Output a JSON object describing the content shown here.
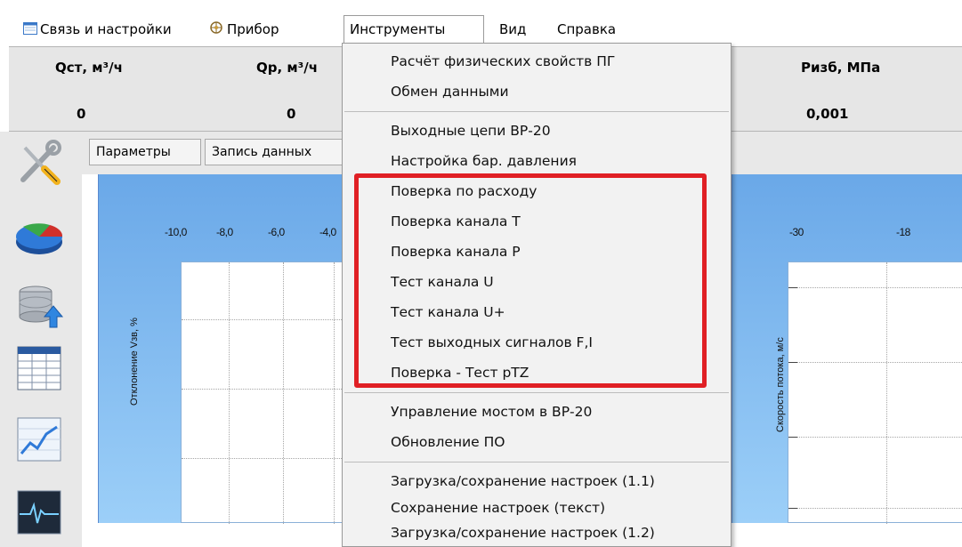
{
  "menubar": {
    "items": [
      {
        "label": "Связь и настройки",
        "icon": "window-icon"
      },
      {
        "label": "Прибор",
        "icon": "device-icon"
      },
      {
        "label": "Инструменты",
        "active": true
      },
      {
        "label": "Вид"
      },
      {
        "label": "Справка"
      }
    ]
  },
  "measurements": [
    {
      "label": "Qст, м³/ч",
      "value": "0"
    },
    {
      "label": "Qр, м³/ч",
      "value": "0"
    },
    {
      "label": "Ризб, МПа",
      "value": "0,001"
    }
  ],
  "tabs": [
    {
      "label": "Параметры"
    },
    {
      "label": "Запись данных"
    }
  ],
  "left_toolbar": {
    "icons": [
      "tools-icon",
      "pie-chart-icon",
      "database-upload-icon",
      "table-icon",
      "line-chart-icon",
      "waveform-icon"
    ]
  },
  "chart_left": {
    "x_ticks": [
      "-10,0",
      "-8,0",
      "-6,0",
      "-4,0"
    ],
    "y_title": "Отклонение Vзв, %"
  },
  "chart_right": {
    "x_ticks": [
      "-30",
      "-18"
    ],
    "y_title": "Скорость потока, м/с"
  },
  "dropdown": {
    "groups": [
      [
        "Расчёт физических свойств ПГ",
        "Обмен данными"
      ],
      [
        "Выходные цепи ВР-20",
        "Настройка бар. давления",
        "Поверка по расходу",
        "Поверка канала Т",
        "Поверка канала Р",
        "Тест канала U",
        "Тест канала U+",
        "Тест выходных сигналов F,I",
        "Поверка - Тест pTZ"
      ],
      [
        "Управление мостом в ВР-20",
        "Обновление ПО"
      ],
      [
        "Загрузка/сохранение настроек (1.1)",
        "Сохранение настроек (текст)",
        "Загрузка/сохранение настроек (1.2)"
      ]
    ]
  },
  "highlight_color": "#e02025",
  "chart_gradient_top": "#6aa8e8",
  "chart_gradient_bottom": "#9ccff8"
}
